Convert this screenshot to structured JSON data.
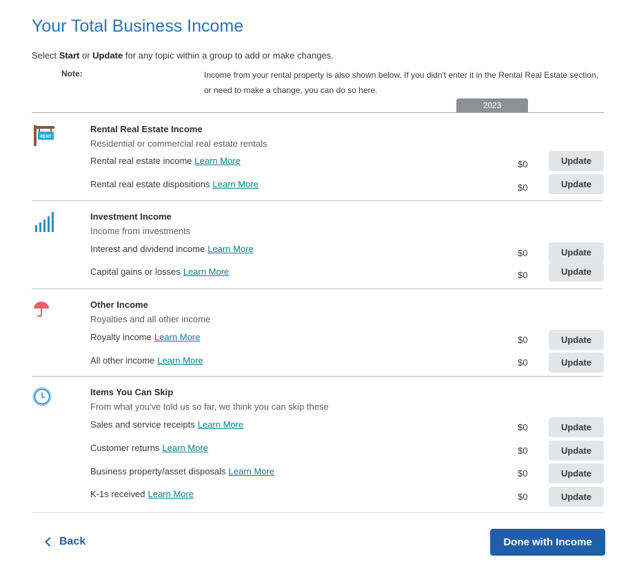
{
  "page": {
    "title": "Your Total Business Income",
    "instructions": {
      "prefix": "Select ",
      "start": "Start",
      "or": " or ",
      "update": "Update",
      "suffix": " for any topic within a group to add or make changes."
    },
    "note_label": "Note:",
    "note_text": "Income from your rental property is also shown below. If you didn't enter it in the Rental Real Estate section, or need to make a change, you can do so here.",
    "year": "2023"
  },
  "learn_more_label": "Learn More",
  "update_label": "Update",
  "groups": [
    {
      "title": "Rental Real Estate Income",
      "subtitle": "Residential or commercial real estate rentals",
      "icon": "rent-sign-icon",
      "rows": [
        {
          "label": "Rental real estate income",
          "amount": "$0"
        },
        {
          "label": "Rental real estate dispositions",
          "amount": "$0"
        }
      ]
    },
    {
      "title": "Investment Income",
      "subtitle": "Income from investments",
      "icon": "bar-chart-icon",
      "rows": [
        {
          "label": "Interest and dividend income",
          "amount": "$0"
        },
        {
          "label": "Capital gains or losses",
          "amount": "$0"
        }
      ]
    },
    {
      "title": "Other Income",
      "subtitle": "Royalties and all other income",
      "icon": "umbrella-icon",
      "rows": [
        {
          "label": "Royalty income",
          "amount": "$0"
        },
        {
          "label": "All other income",
          "amount": "$0"
        }
      ]
    },
    {
      "title": "Items You Can Skip",
      "subtitle": "From what you've told us so far, we think you can skip these",
      "icon": "clock-icon",
      "rows": [
        {
          "label": "Sales and service receipts",
          "amount": "$0"
        },
        {
          "label": "Customer returns",
          "amount": "$0"
        },
        {
          "label": "Business property/asset disposals",
          "amount": "$0"
        },
        {
          "label": "K-1s received",
          "amount": "$0"
        }
      ]
    }
  ],
  "rent_sign_text": "RENT",
  "footer": {
    "back_label": "Back",
    "done_label": "Done with Income"
  },
  "colors": {
    "title": "#2b73b5",
    "link": "#0c7c8c",
    "primary_button": "#1f5fa8",
    "secondary_button": "#e3e6e9",
    "year_tab": "#8d9096"
  }
}
